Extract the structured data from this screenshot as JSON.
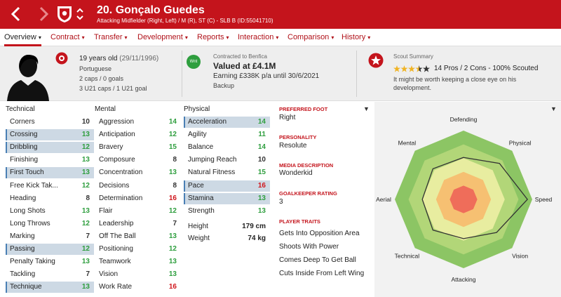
{
  "title_bar": {
    "player_name": "20. Gonçalo Guedes",
    "subtitle": "Attacking Midfielder (Right, Left) / M (R), ST (C) - SLB B (ID:55041710)"
  },
  "menu": [
    {
      "label": "Overview"
    },
    {
      "label": "Contract"
    },
    {
      "label": "Transfer"
    },
    {
      "label": "Development"
    },
    {
      "label": "Reports"
    },
    {
      "label": "Interaction"
    },
    {
      "label": "Comparison"
    },
    {
      "label": "History"
    }
  ],
  "bio": {
    "age": "19 years old",
    "dob": "(29/11/1996)",
    "nationality": "Portuguese",
    "caps": "2 caps / 0 goals",
    "u21": "3 U21 caps / 1 U21 goal"
  },
  "contract": {
    "label": "Contracted to Benfica",
    "badge": "Wnt",
    "value": "Valued at £4.1M",
    "earnings": "Earning £338K p/a until 30/6/2021",
    "role": "Backup"
  },
  "scout": {
    "title": "Scout Summary",
    "stars": 3.5,
    "rating_text": "14 Pros / 2 Cons - 100% Scouted",
    "comment_line1": "It might be worth keeping a close eye on his",
    "comment_line2": "development."
  },
  "colors": {
    "brand": "#c4141c",
    "highlight": "#cdd9e4",
    "green": "#2e9e3e",
    "red": "#d0161c"
  },
  "attributes": {
    "technical": {
      "heading": "Technical",
      "rows": [
        {
          "name": "Corners",
          "value": "10",
          "hl": false
        },
        {
          "name": "Crossing",
          "value": "13",
          "hl": true
        },
        {
          "name": "Dribbling",
          "value": "12",
          "hl": true
        },
        {
          "name": "Finishing",
          "value": "13",
          "hl": false
        },
        {
          "name": "First Touch",
          "value": "13",
          "hl": true
        },
        {
          "name": "Free Kick Tak...",
          "value": "12",
          "hl": false
        },
        {
          "name": "Heading",
          "value": "8",
          "hl": false
        },
        {
          "name": "Long Shots",
          "value": "13",
          "hl": false
        },
        {
          "name": "Long Throws",
          "value": "12",
          "hl": false
        },
        {
          "name": "Marking",
          "value": "7",
          "hl": false
        },
        {
          "name": "Passing",
          "value": "12",
          "hl": true
        },
        {
          "name": "Penalty Taking",
          "value": "13",
          "hl": false
        },
        {
          "name": "Tackling",
          "value": "7",
          "hl": false
        },
        {
          "name": "Technique",
          "value": "13",
          "hl": true
        }
      ]
    },
    "mental": {
      "heading": "Mental",
      "rows": [
        {
          "name": "Aggression",
          "value": "14",
          "hl": false
        },
        {
          "name": "Anticipation",
          "value": "12",
          "hl": false
        },
        {
          "name": "Bravery",
          "value": "15",
          "hl": false
        },
        {
          "name": "Composure",
          "value": "8",
          "hl": false
        },
        {
          "name": "Concentration",
          "value": "13",
          "hl": false
        },
        {
          "name": "Decisions",
          "value": "8",
          "hl": false
        },
        {
          "name": "Determination",
          "value": "16",
          "hl": false
        },
        {
          "name": "Flair",
          "value": "12",
          "hl": false
        },
        {
          "name": "Leadership",
          "value": "7",
          "hl": false
        },
        {
          "name": "Off The Ball",
          "value": "13",
          "hl": false
        },
        {
          "name": "Positioning",
          "value": "12",
          "hl": false
        },
        {
          "name": "Teamwork",
          "value": "13",
          "hl": false
        },
        {
          "name": "Vision",
          "value": "13",
          "hl": false
        },
        {
          "name": "Work Rate",
          "value": "16",
          "hl": false
        }
      ]
    },
    "physical": {
      "heading": "Physical",
      "rows": [
        {
          "name": "Acceleration",
          "value": "14",
          "hl": true
        },
        {
          "name": "Agility",
          "value": "11",
          "hl": false
        },
        {
          "name": "Balance",
          "value": "14",
          "hl": false
        },
        {
          "name": "Jumping Reach",
          "value": "10",
          "hl": false
        },
        {
          "name": "Natural Fitness",
          "value": "15",
          "hl": false
        },
        {
          "name": "Pace",
          "value": "16",
          "hl": true
        },
        {
          "name": "Stamina",
          "value": "13",
          "hl": true
        },
        {
          "name": "Strength",
          "value": "13",
          "hl": false
        }
      ]
    },
    "height_label": "Height",
    "height_value": "179 cm",
    "weight_label": "Weight",
    "weight_value": "74 kg"
  },
  "details": {
    "foot_title": "PREFERRED FOOT",
    "foot_value": "Right",
    "personality_title": "PERSONALITY",
    "personality_value": "Resolute",
    "media_title": "MEDIA DESCRIPTION",
    "media_value": "Wonderkid",
    "gk_title": "GOALKEEPER RATING",
    "gk_value": "3",
    "traits_title": "PLAYER TRAITS",
    "traits": [
      "Gets Into Opposition Area",
      "Shoots With Power",
      "Comes Deep To Get Ball",
      "Cuts Inside From Left Wing"
    ]
  },
  "radar": {
    "labels": [
      "Defending",
      "Physical",
      "Speed",
      "Vision",
      "Attacking",
      "Technical",
      "Aerial",
      "Mental"
    ],
    "values": [
      0.61,
      0.74,
      0.93,
      0.68,
      0.57,
      0.63,
      0.6,
      0.63
    ]
  }
}
